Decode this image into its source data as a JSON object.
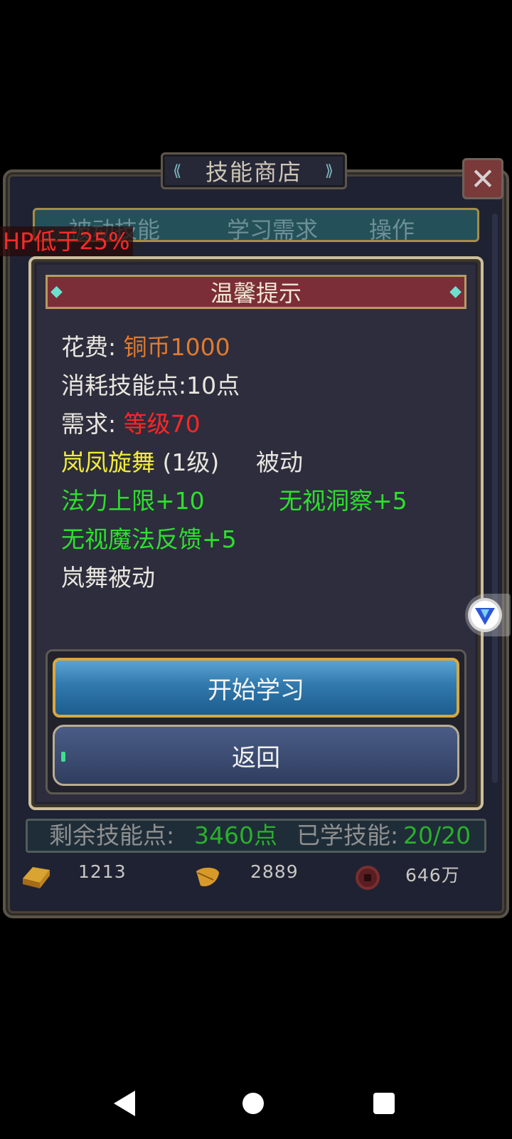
{
  "shop": {
    "title": "技能商店",
    "columns": [
      "被动技能",
      "学习需求",
      "操作"
    ]
  },
  "status": {
    "hp_label": "HP低于25%"
  },
  "dialog": {
    "title": "温馨提示",
    "cost_label": "花费: ",
    "cost_value": "铜币1000",
    "consume_text": "消耗技能点:10点",
    "req_label": "需求: ",
    "req_value": "等级70",
    "skill_name": "岚凤旋舞",
    "skill_level": "(1级)",
    "skill_type": "被动",
    "effects": [
      "法力上限+10",
      "无视洞察+5",
      "无视魔法反馈+5"
    ],
    "description": "岚舞被动",
    "start_button": "开始学习",
    "back_button": "返回"
  },
  "footer": {
    "remaining_label": "剩余技能点: ",
    "remaining_value": "3460点",
    "learned_label": "已学技能:",
    "learned_value": "20/20",
    "gold": "1213",
    "leaf": "2889",
    "coins": "646万"
  },
  "icons": {
    "close": "close-icon",
    "gold": "gold-ingot-icon",
    "leaf": "leaf-icon",
    "coin": "copper-coin-icon",
    "floating": "v-logo-icon"
  },
  "colors": {
    "green": "#2ce12c",
    "red": "#ff2525",
    "orange": "#e07a2e",
    "yellow": "#f3ec3a"
  }
}
